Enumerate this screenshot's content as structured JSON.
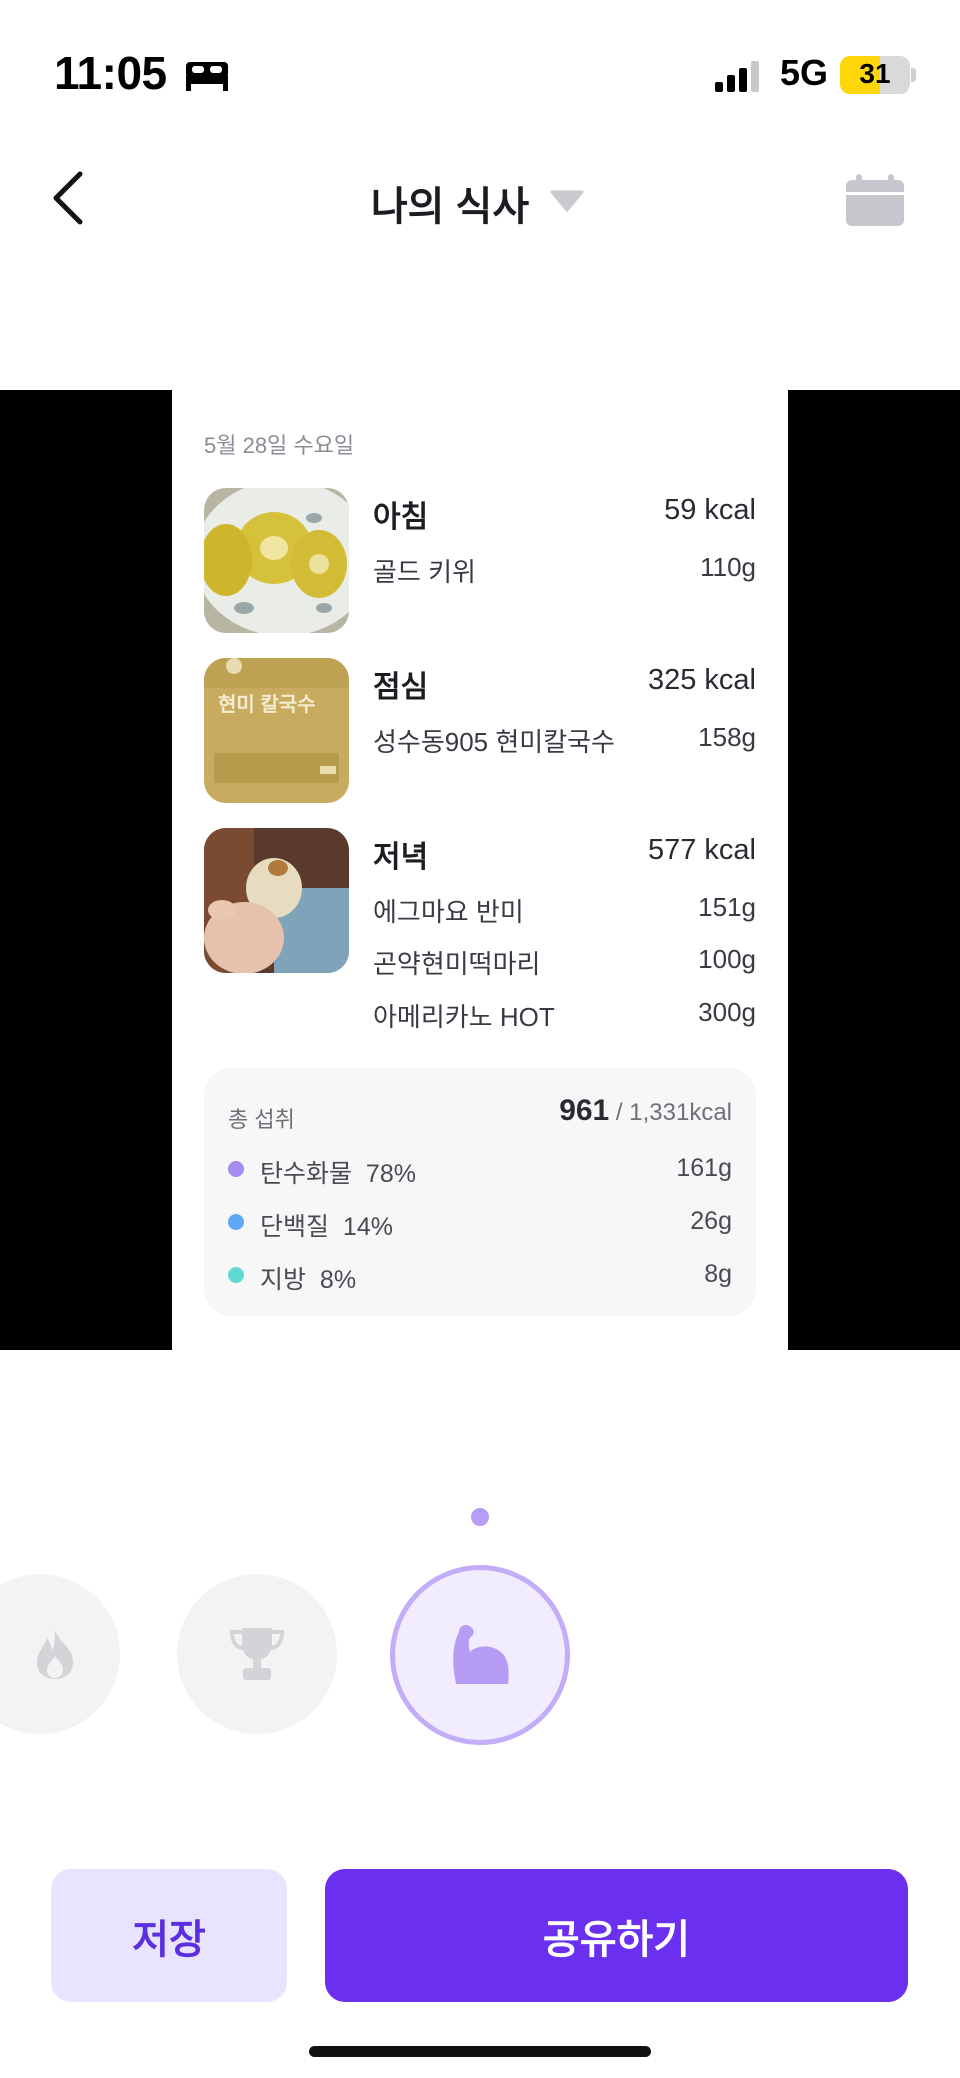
{
  "status_bar": {
    "time": "11:05",
    "network": "5G",
    "battery": "31"
  },
  "nav": {
    "title": "나의 식사"
  },
  "card": {
    "date": "5월 28일 수요일",
    "meals": [
      {
        "title": "아침",
        "kcal": "59 kcal",
        "items": [
          {
            "name": "골드 키위",
            "grams": "110g"
          }
        ]
      },
      {
        "title": "점심",
        "kcal": "325 kcal",
        "items": [
          {
            "name": "성수동905 현미칼국수",
            "grams": "158g"
          }
        ]
      },
      {
        "title": "저녁",
        "kcal": "577 kcal",
        "items": [
          {
            "name": "에그마요 반미",
            "grams": "151g"
          },
          {
            "name": "곤약현미떡마리",
            "grams": "100g"
          },
          {
            "name": "아메리카노 HOT",
            "grams": "300g"
          }
        ]
      }
    ],
    "summary": {
      "label": "총 섭취",
      "total": "961",
      "goal": "/ 1,331kcal",
      "macros": [
        {
          "name": "탄수화물",
          "percent": "78%",
          "grams": "161g",
          "color": "#a58cf0"
        },
        {
          "name": "단백질",
          "percent": "14%",
          "grams": "26g",
          "color": "#5fa8f5"
        },
        {
          "name": "지방",
          "percent": "8%",
          "grams": "8g",
          "color": "#5fd9d2"
        }
      ]
    },
    "thumb_text": {
      "lunch_package": "현미 칼국수"
    }
  },
  "stickers": [
    {
      "icon": "flame-icon",
      "selected": false
    },
    {
      "icon": "trophy-icon",
      "selected": false
    },
    {
      "icon": "muscle-icon",
      "selected": true
    }
  ],
  "actions": {
    "save_label": "저장",
    "share_label": "공유하기"
  },
  "colors": {
    "accent": "#6b2ff0",
    "accent_light": "#e8e3ff",
    "selected_ring": "#c4adf8"
  }
}
